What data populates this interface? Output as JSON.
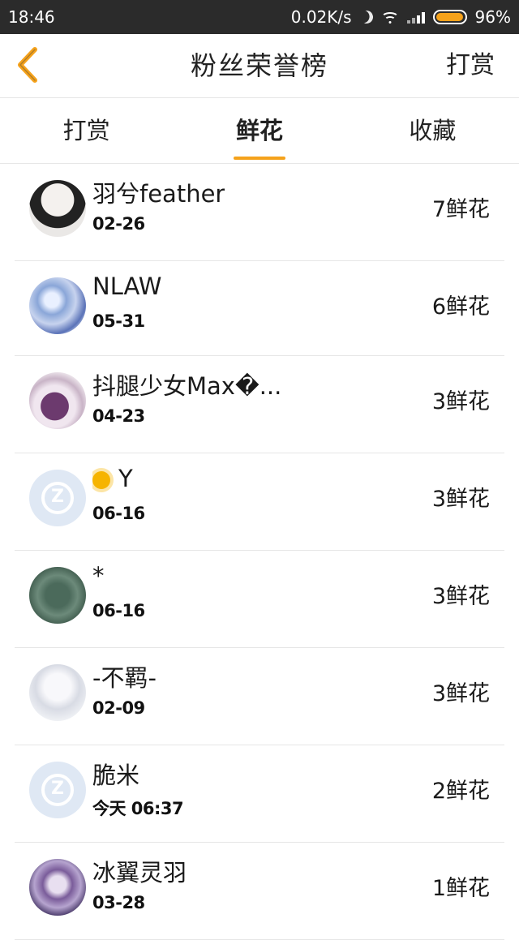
{
  "status_bar": {
    "time": "18:46",
    "net_speed": "0.02K/s",
    "battery": "96%",
    "battery_color": "#f5a21b"
  },
  "header": {
    "back_icon": "chevron-left-icon",
    "title": "粉丝荣誉榜",
    "action": "打赏",
    "accent": "#f5a21b"
  },
  "tabs": [
    {
      "label": "打赏",
      "active": false
    },
    {
      "label": "鲜花",
      "active": true
    },
    {
      "label": "收藏",
      "active": false
    }
  ],
  "list": [
    {
      "name": "羽兮feather",
      "date": "02-26",
      "count": "7鲜花"
    },
    {
      "name": "NLAW",
      "date": "05-31",
      "count": "6鲜花"
    },
    {
      "name": "抖腿少女Max�...",
      "date": "04-23",
      "count": "3鲜花"
    },
    {
      "name": "Y",
      "date": "06-16",
      "count": "3鲜花"
    },
    {
      "name": "*",
      "date": "06-16",
      "count": "3鲜花"
    },
    {
      "name": "-不羁-",
      "date": "02-09",
      "count": "3鲜花"
    },
    {
      "name": "脆米",
      "date": "今天 06:37",
      "count": "2鲜花"
    },
    {
      "name": "冰翼灵羽",
      "date": "03-28",
      "count": "1鲜花"
    }
  ]
}
